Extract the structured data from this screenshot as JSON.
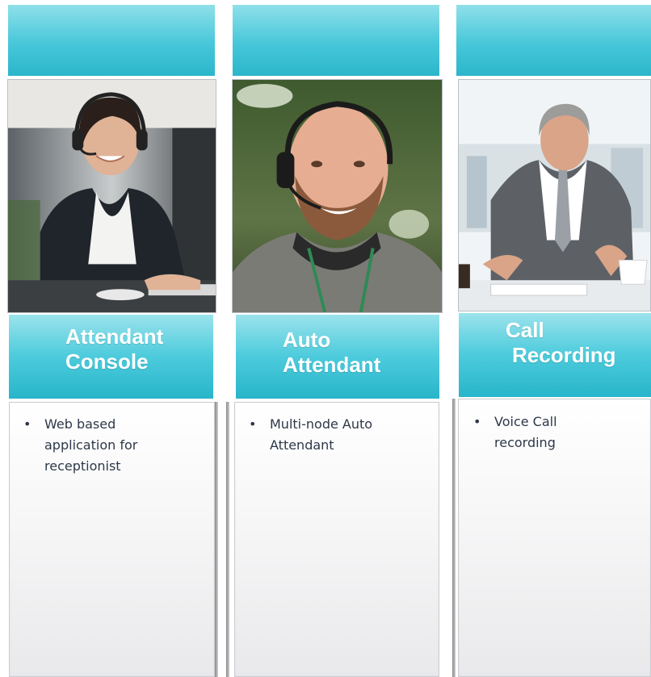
{
  "columns": [
    {
      "title_line1": "Attendant",
      "title_line2": "Console",
      "bullet": "Web based application for receptionist",
      "bullet_lines": [
        "Web based",
        "application for",
        "receptionist"
      ],
      "photo_subject": "receptionist-with-headset-photo"
    },
    {
      "title_line1": "Auto",
      "title_line2": "Attendant",
      "bullet": "Multi-node Auto Attendant",
      "bullet_lines": [
        "Multi-node Auto",
        "Attendant"
      ],
      "photo_subject": "man-with-headset-photo"
    },
    {
      "title_line1": "Call",
      "title_line2": "Recording",
      "bullet": "Voice Call recording",
      "bullet_lines": [
        "Voice Call",
        "recording"
      ],
      "photo_subject": "businessman-in-meeting-photo"
    }
  ],
  "bullet_symbol": "•",
  "colors": {
    "accent_teal": "#2bb6cb",
    "accent_light": "#9be3ec",
    "title_text": "#ffffff",
    "body_text": "#2d3848"
  }
}
